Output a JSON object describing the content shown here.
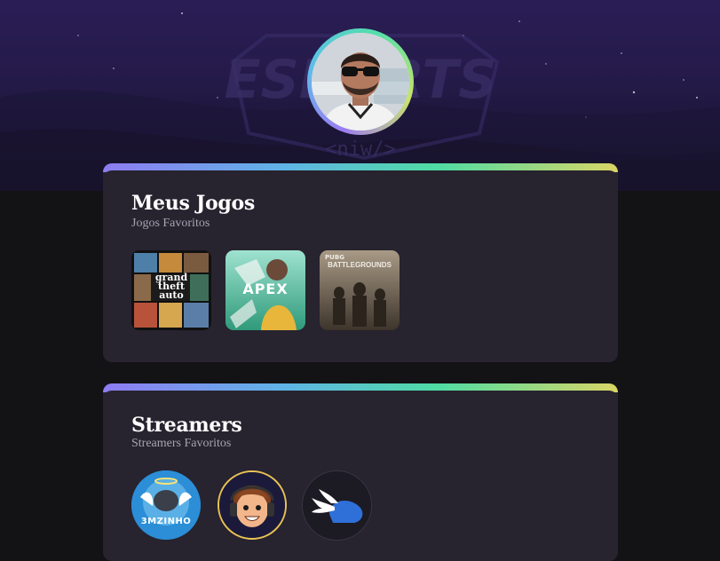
{
  "banner": {
    "logo_text": "ESPORTS",
    "logo_sub": "<niw/>"
  },
  "profile": {
    "avatar_icon": "user-avatar-photo"
  },
  "games_card": {
    "title": "Meus Jogos",
    "subtitle": "Jogos Favoritos",
    "games": [
      {
        "name": "Grand Theft Auto V",
        "cover_text_1": "grand",
        "cover_text_2": "theft",
        "cover_text_3": "auto"
      },
      {
        "name": "Apex Legends",
        "cover_text": "APEX"
      },
      {
        "name": "PUBG Battlegrounds",
        "cover_text_top": "PUBG",
        "cover_text": "BATTLEGROUNDS"
      }
    ]
  },
  "streamers_card": {
    "title": "Streamers",
    "subtitle": "Streamers Favoritos",
    "streamers": [
      {
        "avatar_text": "3MZINHO"
      },
      {
        "avatar_icon": "cartoon-face-avatar"
      },
      {
        "avatar_icon": "winged-helmet-avatar"
      }
    ]
  },
  "colors": {
    "background": "#131215",
    "card": "#27232f",
    "accent_start": "#8e7cf2",
    "accent_mid": "#4fdca3",
    "accent_end": "#d9d565",
    "title": "#ffffff",
    "subtitle": "#a7a3b2"
  }
}
